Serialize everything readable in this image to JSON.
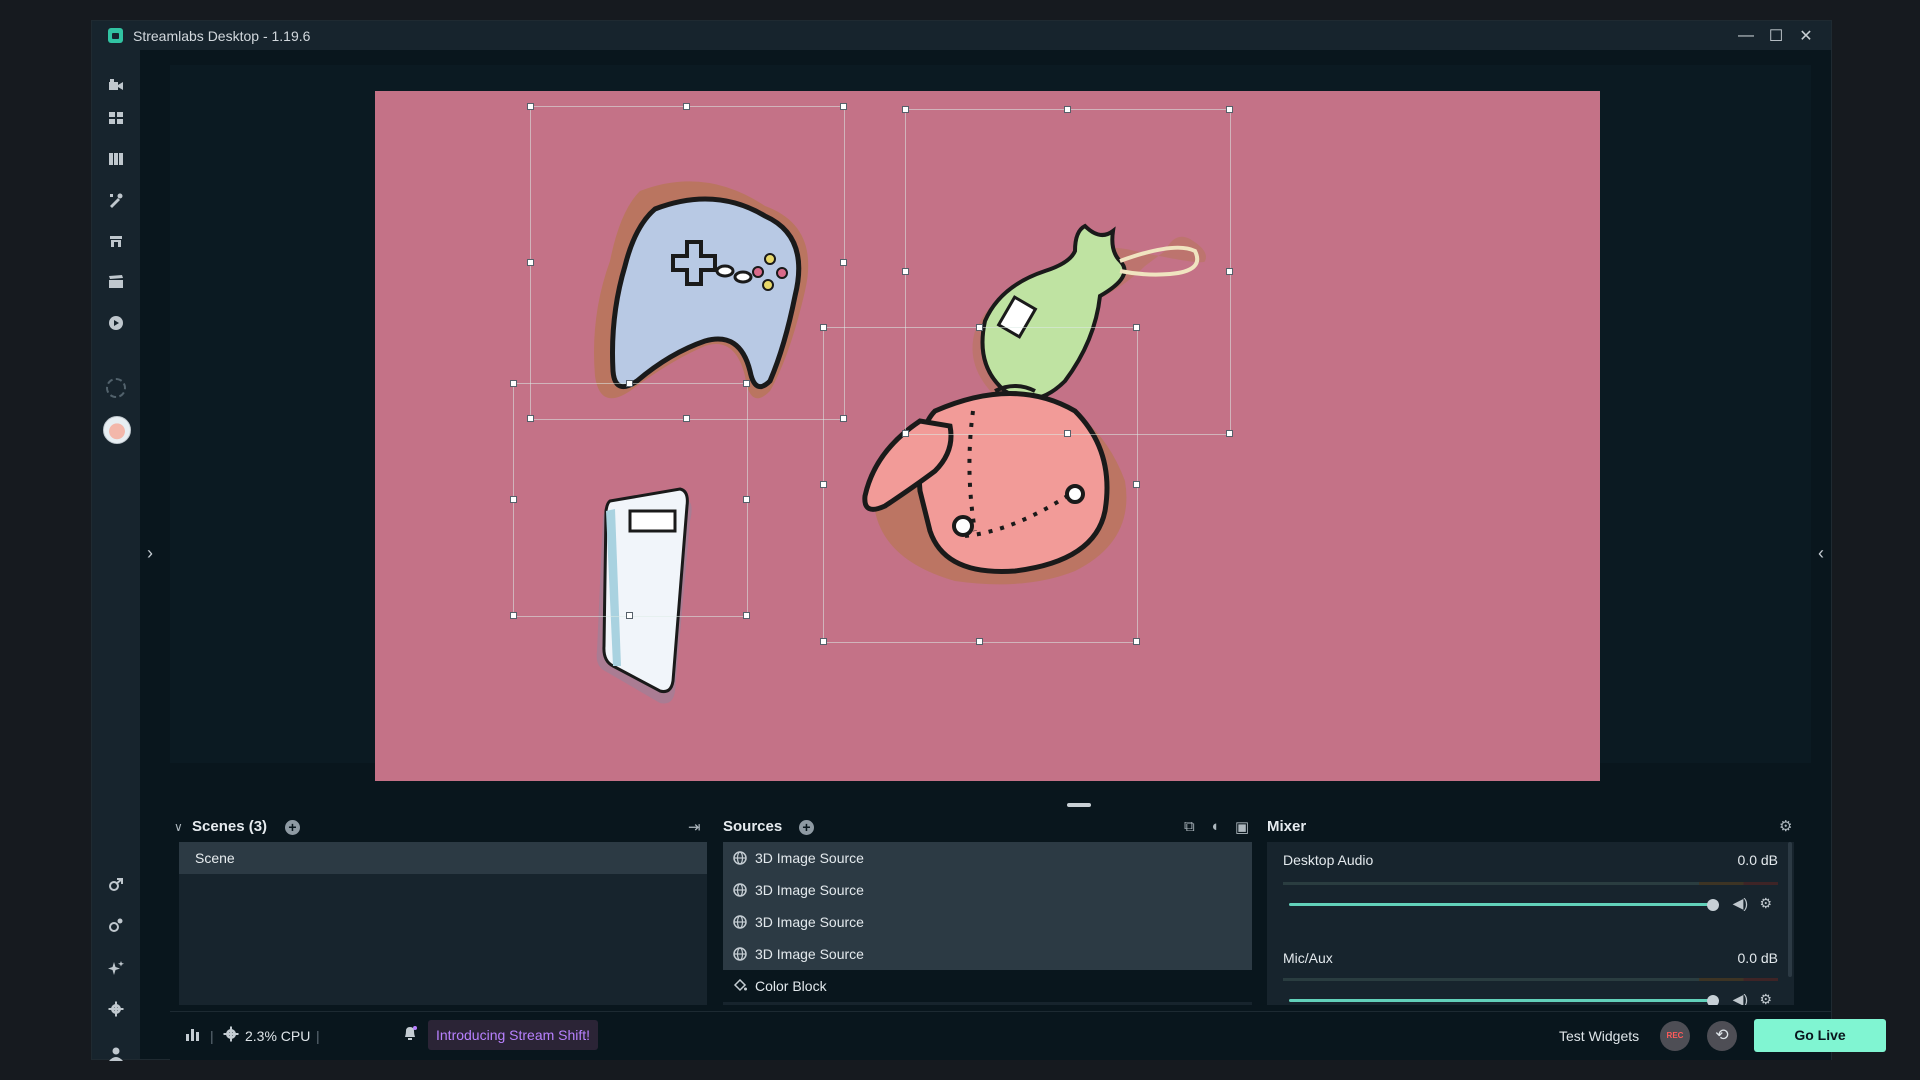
{
  "window": {
    "title": "Streamlabs Desktop - 1.19.6",
    "controls": {
      "minimize": "—",
      "maximize": "☐",
      "close": "✕"
    }
  },
  "sidenav": {
    "top_items": [
      "camera-icon",
      "grid-icon",
      "library-icon",
      "themes-icon",
      "store-icon",
      "highlighter-icon",
      "play-icon"
    ],
    "bottom_items": [
      "link-icon",
      "link-alt-icon",
      "sparkle-icon",
      "gear-icon",
      "user-icon"
    ]
  },
  "editor": {
    "canvas_background": "#c47287",
    "objects": [
      "controller-sticker",
      "money-bag-sticker",
      "notebook-sticker",
      "backpack-sticker"
    ]
  },
  "scenes": {
    "title": "Scenes (3)",
    "items": [
      "Scene"
    ]
  },
  "sources": {
    "title": "Sources",
    "items": [
      {
        "label": "3D Image Source",
        "icon": "globe-icon"
      },
      {
        "label": "3D Image Source",
        "icon": "globe-icon"
      },
      {
        "label": "3D Image Source",
        "icon": "globe-icon"
      },
      {
        "label": "3D Image Source",
        "icon": "globe-icon"
      },
      {
        "label": "Color Block",
        "icon": "paint-bucket-icon"
      }
    ]
  },
  "mixer": {
    "title": "Mixer",
    "items": [
      {
        "name": "Desktop Audio",
        "level": "0.0 dB",
        "volume": 1.0
      },
      {
        "name": "Mic/Aux",
        "level": "0.0 dB",
        "volume": 1.0
      }
    ]
  },
  "footer": {
    "cpu": "2.3% CPU",
    "promo": "Introducing Stream Shift!",
    "test_widgets": "Test Widgets",
    "rec": "REC",
    "go_live": "Go Live"
  },
  "colors": {
    "accent": "#80f5d2",
    "promo_text": "#b881ff",
    "canvas": "#c47287"
  }
}
